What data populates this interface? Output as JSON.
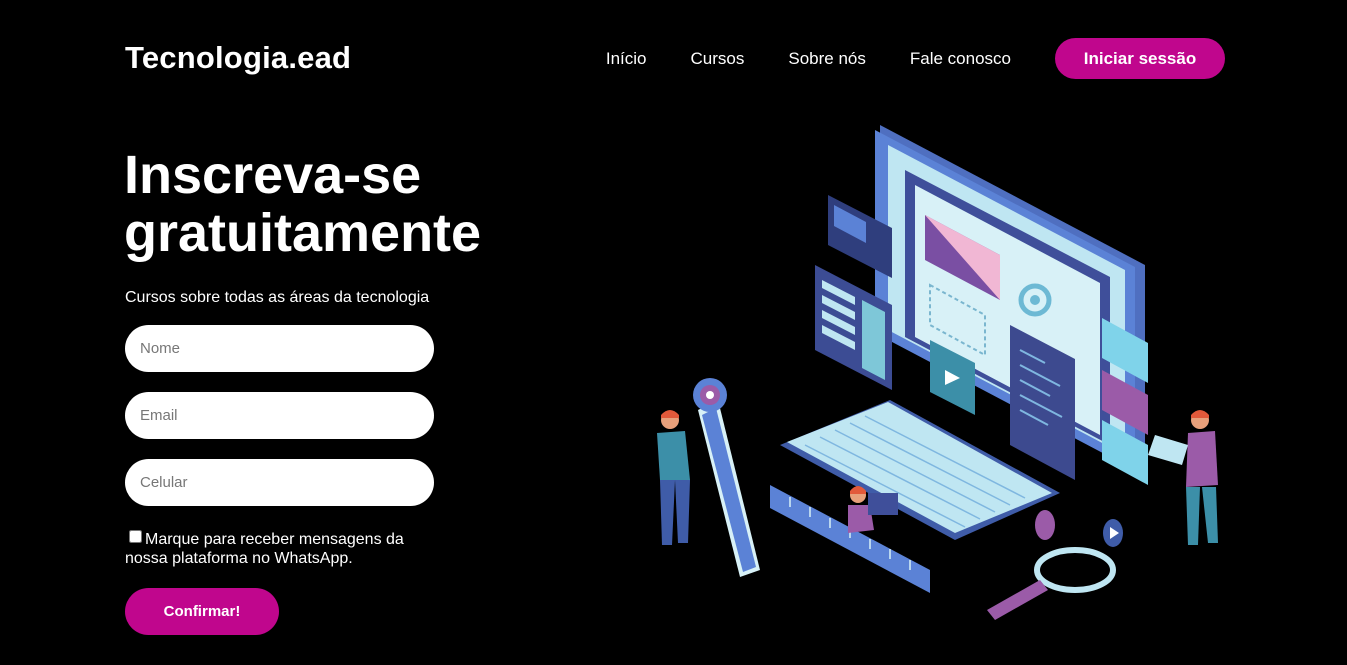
{
  "header": {
    "logo": "Tecnologia.ead",
    "nav": [
      "Início",
      "Cursos",
      "Sobre nós",
      "Fale conosco"
    ],
    "login_label": "Iniciar sessão"
  },
  "hero": {
    "title_line1": "Inscreva-se",
    "title_line2": "gratuitamente",
    "subtitle": "Cursos sobre todas as áreas da tecnologia"
  },
  "form": {
    "name_placeholder": "Nome",
    "email_placeholder": "Email",
    "phone_placeholder": "Celular",
    "optin_label": "Marque para receber mensagens da nossa plataforma no WhatsApp.",
    "optin_checked": false,
    "submit_label": "Confirmar!"
  },
  "colors": {
    "background": "#000000",
    "accent": "#c0068d"
  },
  "illustration": {
    "icon": "computer-workstation-illustration"
  }
}
